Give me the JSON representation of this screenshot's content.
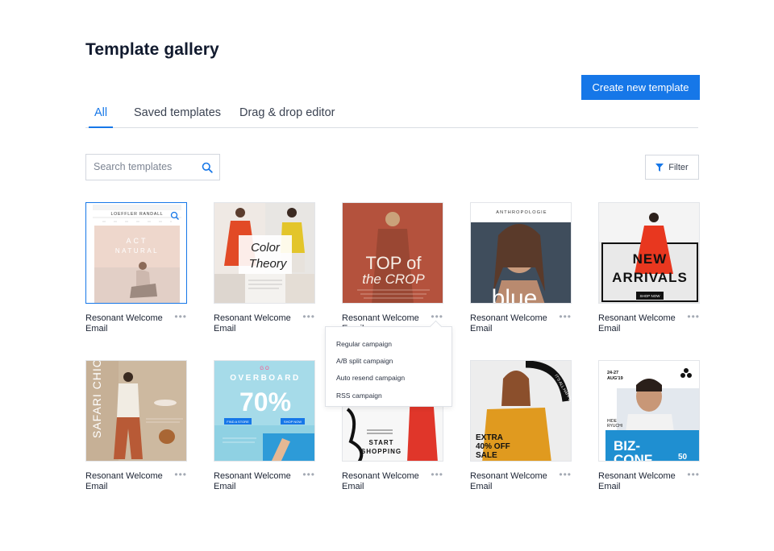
{
  "page": {
    "title": "Template gallery"
  },
  "actions": {
    "create_label": "Create new template",
    "filter_label": "Filter"
  },
  "tabs": [
    {
      "label": "All",
      "active": true
    },
    {
      "label": "Saved templates",
      "active": false
    },
    {
      "label": "Drag & drop editor",
      "active": false
    }
  ],
  "search": {
    "placeholder": "Search templates",
    "icon": "search-icon"
  },
  "templates": [
    {
      "title": "Resonant Welcome Email",
      "thumb_text": [
        "LOEFFLER RANDALL",
        "ACT",
        "NATURAL"
      ],
      "selected": true
    },
    {
      "title": "Resonant Welcome Email",
      "thumb_text": [
        "Color",
        "Theory"
      ]
    },
    {
      "title": "Resonant Welcome Email",
      "thumb_text": [
        "TOP of",
        "the CROP"
      ]
    },
    {
      "title": "Resonant Welcome Email",
      "thumb_text": [
        "ANTHROPOLOGIE",
        "blue"
      ]
    },
    {
      "title": "Resonant Welcome Email",
      "thumb_text": [
        "NEW",
        "ARRIVALS",
        "SHOP NOW"
      ]
    },
    {
      "title": "Resonant Welcome Email",
      "thumb_text": [
        "SAFARI CHIC"
      ]
    },
    {
      "title": "Resonant Welcome Email",
      "thumb_text": [
        "GO",
        "OVERBOARD",
        "70%",
        "FIND A STORE",
        "SHOP NOW"
      ]
    },
    {
      "title": "Resonant Welcome Email",
      "thumb_text": [
        "START",
        "SHOPPING"
      ]
    },
    {
      "title": "Resonant Welcome Email",
      "thumb_text": [
        "EXTRA",
        "40% OFF",
        "SALE",
        "IT'S ALL HAPPENING"
      ]
    },
    {
      "title": "Resonant Welcome Email",
      "thumb_text": [
        "24-27",
        "AUG'19",
        "HIDE",
        "RYUCHI",
        "BIZ-",
        "CONF",
        "50"
      ]
    }
  ],
  "dropdown": {
    "items": [
      "Regular campaign",
      "A/B split campaign",
      "Auto resend campaign",
      "RSS campaign"
    ]
  },
  "colors": {
    "accent": "#1677e8",
    "text": "#111a2e",
    "border": "#d3d7de"
  }
}
